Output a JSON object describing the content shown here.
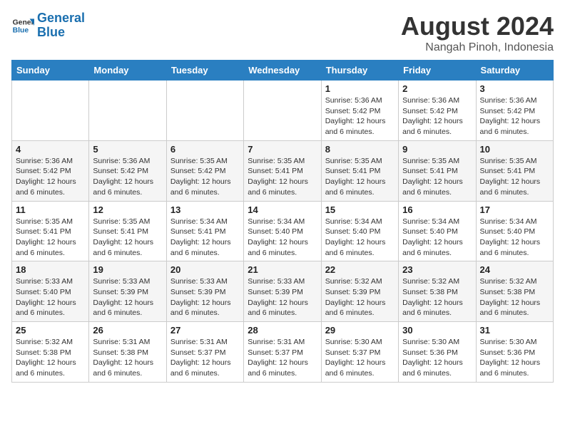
{
  "header": {
    "logo_general": "General",
    "logo_blue": "Blue",
    "month_year": "August 2024",
    "location": "Nangah Pinoh, Indonesia"
  },
  "weekdays": [
    "Sunday",
    "Monday",
    "Tuesday",
    "Wednesday",
    "Thursday",
    "Friday",
    "Saturday"
  ],
  "weeks": [
    [
      {
        "day": "",
        "info": ""
      },
      {
        "day": "",
        "info": ""
      },
      {
        "day": "",
        "info": ""
      },
      {
        "day": "",
        "info": ""
      },
      {
        "day": "1",
        "info": "Sunrise: 5:36 AM\nSunset: 5:42 PM\nDaylight: 12 hours and 6 minutes."
      },
      {
        "day": "2",
        "info": "Sunrise: 5:36 AM\nSunset: 5:42 PM\nDaylight: 12 hours and 6 minutes."
      },
      {
        "day": "3",
        "info": "Sunrise: 5:36 AM\nSunset: 5:42 PM\nDaylight: 12 hours and 6 minutes."
      }
    ],
    [
      {
        "day": "4",
        "info": "Sunrise: 5:36 AM\nSunset: 5:42 PM\nDaylight: 12 hours and 6 minutes."
      },
      {
        "day": "5",
        "info": "Sunrise: 5:36 AM\nSunset: 5:42 PM\nDaylight: 12 hours and 6 minutes."
      },
      {
        "day": "6",
        "info": "Sunrise: 5:35 AM\nSunset: 5:42 PM\nDaylight: 12 hours and 6 minutes."
      },
      {
        "day": "7",
        "info": "Sunrise: 5:35 AM\nSunset: 5:41 PM\nDaylight: 12 hours and 6 minutes."
      },
      {
        "day": "8",
        "info": "Sunrise: 5:35 AM\nSunset: 5:41 PM\nDaylight: 12 hours and 6 minutes."
      },
      {
        "day": "9",
        "info": "Sunrise: 5:35 AM\nSunset: 5:41 PM\nDaylight: 12 hours and 6 minutes."
      },
      {
        "day": "10",
        "info": "Sunrise: 5:35 AM\nSunset: 5:41 PM\nDaylight: 12 hours and 6 minutes."
      }
    ],
    [
      {
        "day": "11",
        "info": "Sunrise: 5:35 AM\nSunset: 5:41 PM\nDaylight: 12 hours and 6 minutes."
      },
      {
        "day": "12",
        "info": "Sunrise: 5:35 AM\nSunset: 5:41 PM\nDaylight: 12 hours and 6 minutes."
      },
      {
        "day": "13",
        "info": "Sunrise: 5:34 AM\nSunset: 5:41 PM\nDaylight: 12 hours and 6 minutes."
      },
      {
        "day": "14",
        "info": "Sunrise: 5:34 AM\nSunset: 5:40 PM\nDaylight: 12 hours and 6 minutes."
      },
      {
        "day": "15",
        "info": "Sunrise: 5:34 AM\nSunset: 5:40 PM\nDaylight: 12 hours and 6 minutes."
      },
      {
        "day": "16",
        "info": "Sunrise: 5:34 AM\nSunset: 5:40 PM\nDaylight: 12 hours and 6 minutes."
      },
      {
        "day": "17",
        "info": "Sunrise: 5:34 AM\nSunset: 5:40 PM\nDaylight: 12 hours and 6 minutes."
      }
    ],
    [
      {
        "day": "18",
        "info": "Sunrise: 5:33 AM\nSunset: 5:40 PM\nDaylight: 12 hours and 6 minutes."
      },
      {
        "day": "19",
        "info": "Sunrise: 5:33 AM\nSunset: 5:39 PM\nDaylight: 12 hours and 6 minutes."
      },
      {
        "day": "20",
        "info": "Sunrise: 5:33 AM\nSunset: 5:39 PM\nDaylight: 12 hours and 6 minutes."
      },
      {
        "day": "21",
        "info": "Sunrise: 5:33 AM\nSunset: 5:39 PM\nDaylight: 12 hours and 6 minutes."
      },
      {
        "day": "22",
        "info": "Sunrise: 5:32 AM\nSunset: 5:39 PM\nDaylight: 12 hours and 6 minutes."
      },
      {
        "day": "23",
        "info": "Sunrise: 5:32 AM\nSunset: 5:38 PM\nDaylight: 12 hours and 6 minutes."
      },
      {
        "day": "24",
        "info": "Sunrise: 5:32 AM\nSunset: 5:38 PM\nDaylight: 12 hours and 6 minutes."
      }
    ],
    [
      {
        "day": "25",
        "info": "Sunrise: 5:32 AM\nSunset: 5:38 PM\nDaylight: 12 hours and 6 minutes."
      },
      {
        "day": "26",
        "info": "Sunrise: 5:31 AM\nSunset: 5:38 PM\nDaylight: 12 hours and 6 minutes."
      },
      {
        "day": "27",
        "info": "Sunrise: 5:31 AM\nSunset: 5:37 PM\nDaylight: 12 hours and 6 minutes."
      },
      {
        "day": "28",
        "info": "Sunrise: 5:31 AM\nSunset: 5:37 PM\nDaylight: 12 hours and 6 minutes."
      },
      {
        "day": "29",
        "info": "Sunrise: 5:30 AM\nSunset: 5:37 PM\nDaylight: 12 hours and 6 minutes."
      },
      {
        "day": "30",
        "info": "Sunrise: 5:30 AM\nSunset: 5:36 PM\nDaylight: 12 hours and 6 minutes."
      },
      {
        "day": "31",
        "info": "Sunrise: 5:30 AM\nSunset: 5:36 PM\nDaylight: 12 hours and 6 minutes."
      }
    ]
  ]
}
